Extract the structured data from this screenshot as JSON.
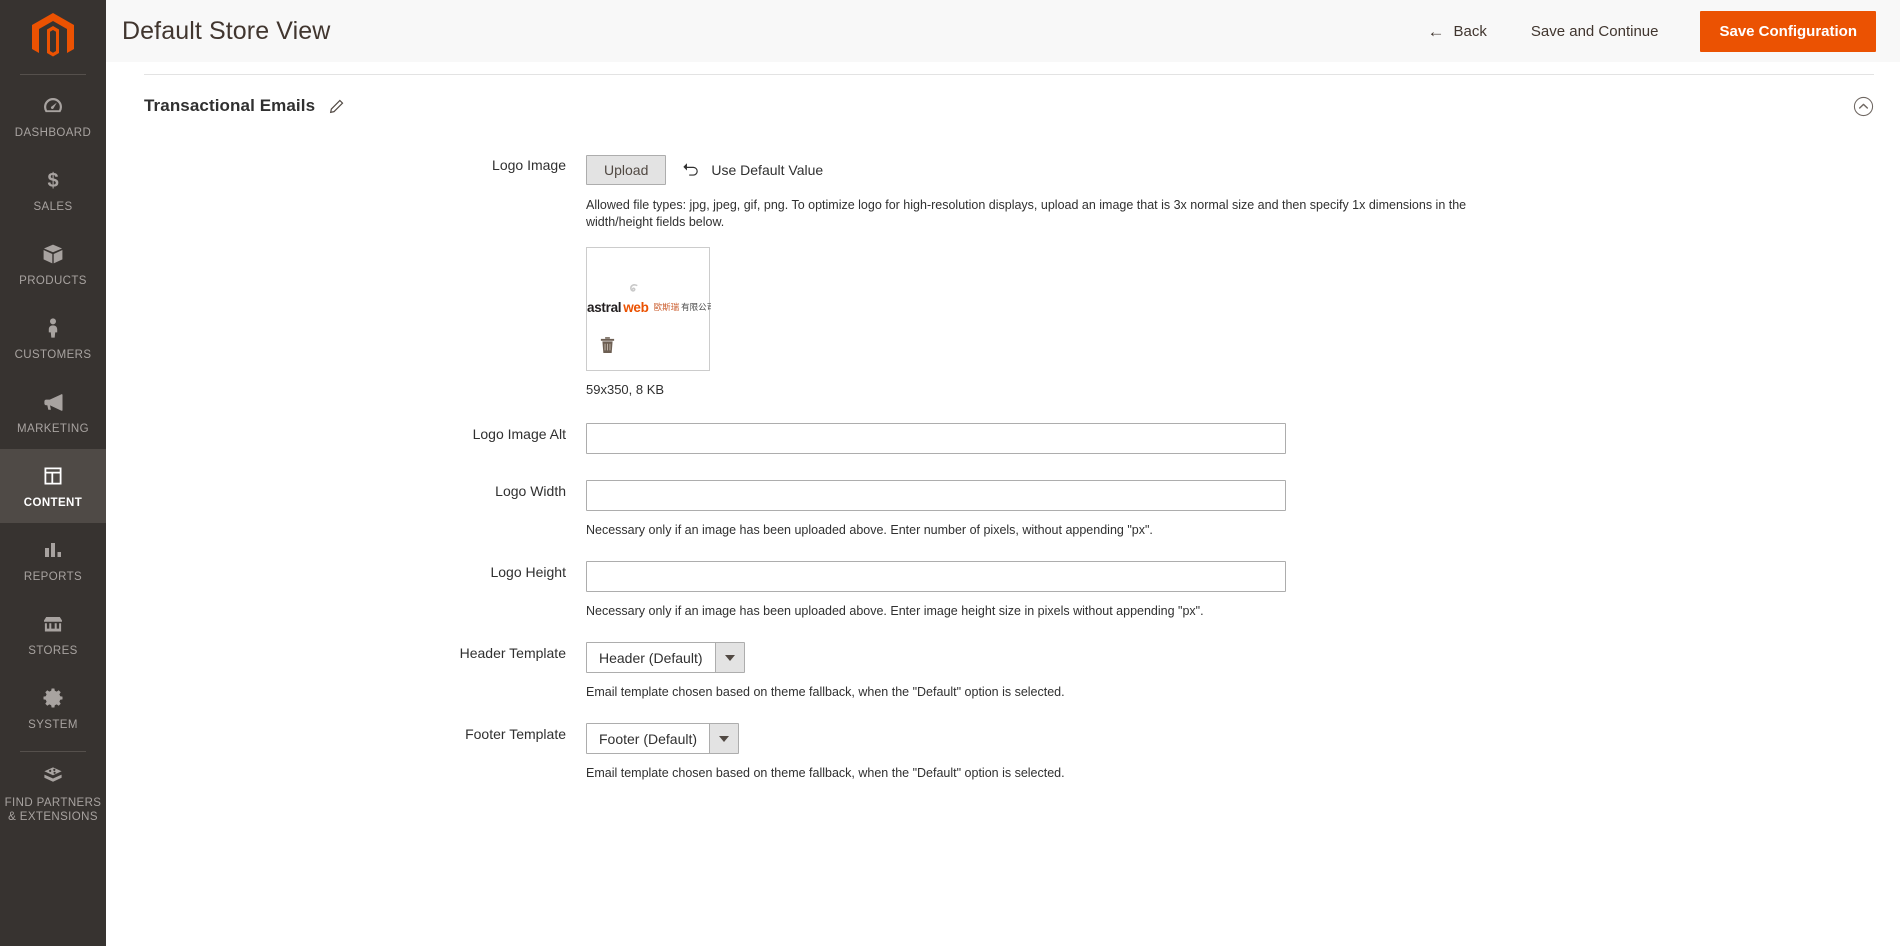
{
  "sidebar": {
    "logo_name": "magento-logo-icon",
    "items": [
      {
        "label": "DASHBOARD",
        "icon": "dashboard-icon",
        "active": false
      },
      {
        "label": "SALES",
        "icon": "dollar-icon",
        "active": false
      },
      {
        "label": "PRODUCTS",
        "icon": "box-icon",
        "active": false
      },
      {
        "label": "CUSTOMERS",
        "icon": "person-icon",
        "active": false
      },
      {
        "label": "MARKETING",
        "icon": "megaphone-icon",
        "active": false
      },
      {
        "label": "CONTENT",
        "icon": "layout-icon",
        "active": true
      },
      {
        "label": "REPORTS",
        "icon": "bar-chart-icon",
        "active": false
      },
      {
        "label": "STORES",
        "icon": "storefront-icon",
        "active": false
      },
      {
        "label": "SYSTEM",
        "icon": "gear-icon",
        "active": false
      },
      {
        "label": "FIND PARTNERS\n& EXTENSIONS",
        "icon": "extension-icon",
        "active": false
      }
    ]
  },
  "header": {
    "title": "Default Store View",
    "back_label": "Back",
    "save_continue_label": "Save and Continue",
    "save_config_label": "Save Configuration",
    "accent_color": "#eb5202"
  },
  "section": {
    "title": "Transactional Emails",
    "edit_icon": "pencil-icon",
    "collapse_icon": "chevron-up-circle-icon"
  },
  "fields": {
    "logo_image": {
      "label": "Logo Image",
      "upload_label": "Upload",
      "use_default_label": "Use Default Value",
      "use_default_icon": "undo-arrow-icon",
      "help": "Allowed file types: jpg, jpeg, gif, png. To optimize logo for high-resolution displays, upload an image that is 3x normal size and then specify 1x dimensions in the width/height fields below.",
      "preview": {
        "logo_text_dark": "astral",
        "logo_text_accent": "web",
        "logo_text_cn_accent": "歐斯瑞",
        "logo_text_cn_dark": "有限公司",
        "delete_icon": "trash-icon"
      },
      "file_meta": "59x350, 8 KB"
    },
    "logo_image_alt": {
      "label": "Logo Image Alt",
      "value": "",
      "placeholder": ""
    },
    "logo_width": {
      "label": "Logo Width",
      "value": "",
      "placeholder": "",
      "help": "Necessary only if an image has been uploaded above. Enter number of pixels, without appending \"px\"."
    },
    "logo_height": {
      "label": "Logo Height",
      "value": "",
      "placeholder": "",
      "help": "Necessary only if an image has been uploaded above. Enter image height size in pixels without appending \"px\"."
    },
    "header_template": {
      "label": "Header Template",
      "value": "Header (Default)",
      "help": "Email template chosen based on theme fallback, when the \"Default\" option is selected."
    },
    "footer_template": {
      "label": "Footer Template",
      "value": "Footer (Default)",
      "help": "Email template chosen based on theme fallback, when the \"Default\" option is selected."
    }
  }
}
